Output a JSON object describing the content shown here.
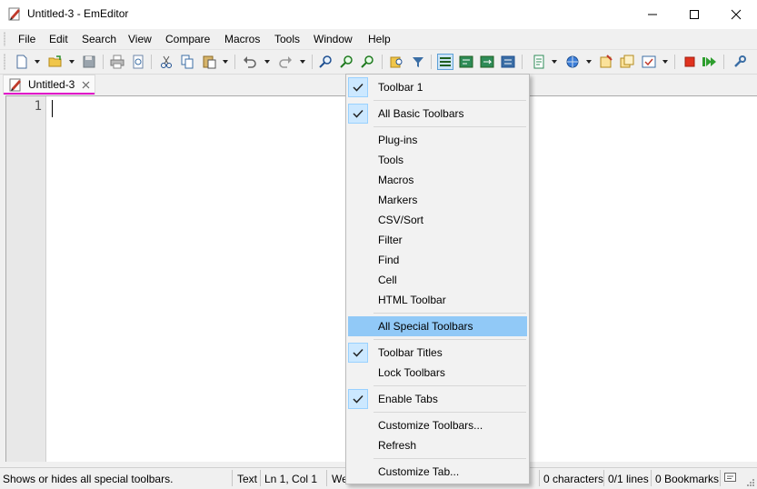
{
  "window": {
    "title": "Untitled-3 - EmEditor"
  },
  "menubar": [
    "File",
    "Edit",
    "Search",
    "View",
    "Compare",
    "Macros",
    "Tools",
    "Window",
    "Help"
  ],
  "tab": {
    "label": "Untitled-3"
  },
  "editor": {
    "line_number": "1"
  },
  "statusbar": {
    "message": "Shows or hides all special toolbars.",
    "mode": "Text",
    "position": "Ln 1, Col 1",
    "partial": "We",
    "characters": "0 characters",
    "lines": "0/1 lines",
    "bookmarks": "0 Bookmarks"
  },
  "context_menu": {
    "items": [
      {
        "label": "Toolbar 1",
        "checked": true
      },
      {
        "label": "All Basic Toolbars",
        "checked": true
      },
      {
        "label": "Plug-ins",
        "checked": false
      },
      {
        "label": "Tools",
        "checked": false
      },
      {
        "label": "Macros",
        "checked": false
      },
      {
        "label": "Markers",
        "checked": false
      },
      {
        "label": "CSV/Sort",
        "checked": false
      },
      {
        "label": "Filter",
        "checked": false
      },
      {
        "label": "Find",
        "checked": false
      },
      {
        "label": "Cell",
        "checked": false
      },
      {
        "label": "HTML Toolbar",
        "checked": false
      },
      {
        "label": "All Special Toolbars",
        "checked": false,
        "highlighted": true
      },
      {
        "label": "Toolbar Titles",
        "checked": true
      },
      {
        "label": "Lock Toolbars",
        "checked": false
      },
      {
        "label": "Enable Tabs",
        "checked": true
      },
      {
        "label": "Customize Toolbars...",
        "checked": false
      },
      {
        "label": "Refresh",
        "checked": false
      },
      {
        "label": "Customize Tab...",
        "checked": false
      }
    ]
  },
  "colors": {
    "accent_tab": "#e000c8",
    "menu_highlight": "#91c9f7",
    "check_bg": "#cce8ff"
  }
}
